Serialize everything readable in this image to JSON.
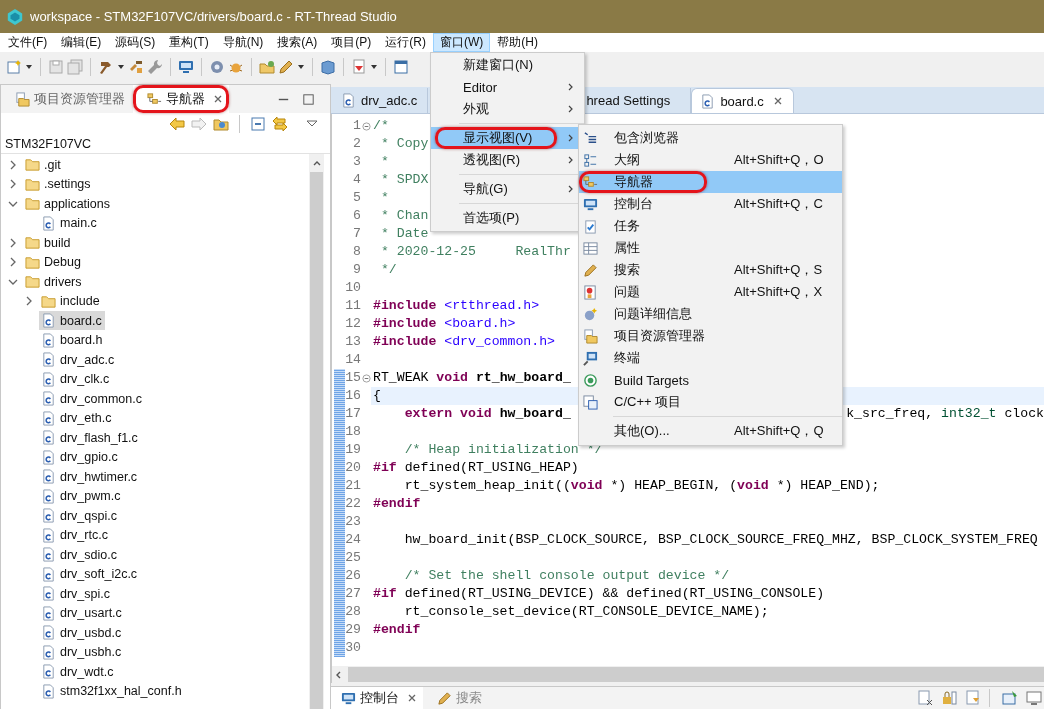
{
  "window": {
    "title": "workspace - STM32F107VC/drivers/board.c - RT-Thread Studio"
  },
  "menu_bar": [
    {
      "label": "文件(F)",
      "selected": false
    },
    {
      "label": "编辑(E)",
      "selected": false
    },
    {
      "label": "源码(S)",
      "selected": false
    },
    {
      "label": "重构(T)",
      "selected": false
    },
    {
      "label": "导航(N)",
      "selected": false
    },
    {
      "label": "搜索(A)",
      "selected": false
    },
    {
      "label": "项目(P)",
      "selected": false
    },
    {
      "label": "运行(R)",
      "selected": false
    },
    {
      "label": "窗口(W)",
      "selected": true
    },
    {
      "label": "帮助(H)",
      "selected": false
    }
  ],
  "left_panel": {
    "tabs": [
      {
        "label": "项目资源管理器",
        "selected": false,
        "highlighted": false
      },
      {
        "label": "导航器",
        "selected": true,
        "highlighted": true
      }
    ],
    "root": "STM32F107VC",
    "tree": [
      {
        "name": ".git",
        "kind": "folder",
        "expanded": false,
        "selected": false
      },
      {
        "name": ".settings",
        "kind": "folder",
        "expanded": false,
        "selected": false
      },
      {
        "name": "applications",
        "kind": "folder",
        "expanded": true,
        "selected": false,
        "children": [
          {
            "name": "main.c",
            "kind": "file",
            "selected": false
          }
        ]
      },
      {
        "name": "build",
        "kind": "folder",
        "expanded": false,
        "selected": false
      },
      {
        "name": "Debug",
        "kind": "folder",
        "expanded": false,
        "selected": false
      },
      {
        "name": "drivers",
        "kind": "folder",
        "expanded": true,
        "selected": false,
        "children": [
          {
            "name": "include",
            "kind": "folder",
            "expanded": false,
            "selected": false
          },
          {
            "name": "board.c",
            "kind": "file",
            "selected": true
          },
          {
            "name": "board.h",
            "kind": "file",
            "selected": false
          },
          {
            "name": "drv_adc.c",
            "kind": "file",
            "selected": false
          },
          {
            "name": "drv_clk.c",
            "kind": "file",
            "selected": false
          },
          {
            "name": "drv_common.c",
            "kind": "file",
            "selected": false
          },
          {
            "name": "drv_eth.c",
            "kind": "file",
            "selected": false
          },
          {
            "name": "drv_flash_f1.c",
            "kind": "file",
            "selected": false
          },
          {
            "name": "drv_gpio.c",
            "kind": "file",
            "selected": false
          },
          {
            "name": "drv_hwtimer.c",
            "kind": "file",
            "selected": false
          },
          {
            "name": "drv_pwm.c",
            "kind": "file",
            "selected": false
          },
          {
            "name": "drv_qspi.c",
            "kind": "file",
            "selected": false
          },
          {
            "name": "drv_rtc.c",
            "kind": "file",
            "selected": false
          },
          {
            "name": "drv_sdio.c",
            "kind": "file",
            "selected": false
          },
          {
            "name": "drv_soft_i2c.c",
            "kind": "file",
            "selected": false
          },
          {
            "name": "drv_spi.c",
            "kind": "file",
            "selected": false
          },
          {
            "name": "drv_usart.c",
            "kind": "file",
            "selected": false
          },
          {
            "name": "drv_usbd.c",
            "kind": "file",
            "selected": false
          },
          {
            "name": "drv_usbh.c",
            "kind": "file",
            "selected": false
          },
          {
            "name": "drv_wdt.c",
            "kind": "file",
            "selected": false
          },
          {
            "name": "stm32f1xx_hal_conf.h",
            "kind": "file",
            "selected": false
          }
        ]
      }
    ]
  },
  "editor": {
    "tabs": [
      {
        "label": "drv_adc.c",
        "selected": false,
        "kind": "file"
      },
      {
        "label": "hread Settings",
        "selected": false,
        "kind": "settings"
      },
      {
        "label": "board.c",
        "selected": true,
        "kind": "file"
      }
    ],
    "lines": [
      {
        "n": "1",
        "fold": true,
        "changed": false,
        "current": false,
        "tokens": [
          {
            "kind": "comment",
            "text": "/*"
          }
        ]
      },
      {
        "n": "2",
        "fold": false,
        "changed": false,
        "current": false,
        "tokens": [
          {
            "kind": "comment",
            "text": " * Copy"
          }
        ]
      },
      {
        "n": "3",
        "fold": false,
        "changed": false,
        "current": false,
        "tokens": [
          {
            "kind": "comment",
            "text": " *"
          }
        ]
      },
      {
        "n": "4",
        "fold": false,
        "changed": false,
        "current": false,
        "tokens": [
          {
            "kind": "comment",
            "text": " * SPDX"
          }
        ]
      },
      {
        "n": "5",
        "fold": false,
        "changed": false,
        "current": false,
        "tokens": [
          {
            "kind": "comment",
            "text": " *"
          }
        ]
      },
      {
        "n": "6",
        "fold": false,
        "changed": false,
        "current": false,
        "tokens": [
          {
            "kind": "comment",
            "text": " * Chan"
          }
        ]
      },
      {
        "n": "7",
        "fold": false,
        "changed": false,
        "current": false,
        "tokens": [
          {
            "kind": "comment",
            "text": " * Date"
          }
        ]
      },
      {
        "n": "8",
        "fold": false,
        "changed": false,
        "current": false,
        "tokens": [
          {
            "kind": "comment",
            "text": " * 2020-12-25     RealThr"
          }
        ]
      },
      {
        "n": "9",
        "fold": false,
        "changed": false,
        "current": false,
        "tokens": [
          {
            "kind": "comment",
            "text": " */"
          }
        ]
      },
      {
        "n": "10",
        "fold": false,
        "changed": false,
        "current": false
      },
      {
        "n": "11",
        "fold": false,
        "changed": false,
        "current": false,
        "tokens": [
          {
            "kind": "keyword",
            "text": "#include"
          },
          {
            "kind": "string",
            "text": " <rtthread.h>"
          }
        ]
      },
      {
        "n": "12",
        "fold": false,
        "changed": false,
        "current": false,
        "tokens": [
          {
            "kind": "keyword",
            "text": "#include"
          },
          {
            "kind": "string",
            "text": " <board.h>"
          }
        ]
      },
      {
        "n": "13",
        "fold": false,
        "changed": false,
        "current": false,
        "tokens": [
          {
            "kind": "keyword",
            "text": "#include"
          },
          {
            "kind": "string",
            "text": " <drv_common.h>"
          }
        ]
      },
      {
        "n": "14",
        "fold": false,
        "changed": false,
        "current": false
      },
      {
        "n": "15",
        "fold": true,
        "changed": true,
        "current": false,
        "tokens": [
          {
            "kind": "plain",
            "text": "RT_WEAK"
          },
          {
            "kind": "keyword",
            "text": " void"
          },
          {
            "kind": "function",
            "text": " rt_hw_board_"
          }
        ]
      },
      {
        "n": "16",
        "fold": false,
        "changed": true,
        "current": true,
        "tokens": [
          {
            "kind": "plain",
            "text": "{"
          }
        ]
      },
      {
        "n": "17",
        "fold": false,
        "changed": true,
        "current": false,
        "tokens": [
          {
            "kind": "keyword",
            "text": "    extern"
          },
          {
            "kind": "keyword",
            "text": " void"
          },
          {
            "kind": "function",
            "text": " hw_board_"
          }
        ],
        "tail": [
          {
            "kind": "plain",
            "text": "k_src_freq,"
          },
          {
            "kind": "type",
            "text": " int32_t"
          },
          {
            "kind": "plain",
            "text": " clock"
          }
        ]
      },
      {
        "n": "18",
        "fold": false,
        "changed": true,
        "current": false
      },
      {
        "n": "19",
        "fold": false,
        "changed": true,
        "current": false,
        "tokens": [
          {
            "kind": "comment",
            "text": "    /* Heap initialization */"
          }
        ]
      },
      {
        "n": "20",
        "fold": false,
        "changed": true,
        "current": false,
        "tokens": [
          {
            "kind": "keyword",
            "text": "#if"
          },
          {
            "kind": "plain",
            "text": " defined(RT_USING_HEAP)"
          }
        ]
      },
      {
        "n": "21",
        "fold": false,
        "changed": true,
        "current": false,
        "tokens": [
          {
            "kind": "plain",
            "text": "    rt_system_heap_init(("
          },
          {
            "kind": "keyword",
            "text": "void"
          },
          {
            "kind": "plain",
            "text": " *) HEAP_BEGIN, ("
          },
          {
            "kind": "keyword",
            "text": "void"
          },
          {
            "kind": "plain",
            "text": " *) HEAP_END);"
          }
        ]
      },
      {
        "n": "22",
        "fold": false,
        "changed": true,
        "current": false,
        "tokens": [
          {
            "kind": "keyword",
            "text": "#endif"
          }
        ]
      },
      {
        "n": "23",
        "fold": false,
        "changed": true,
        "current": false
      },
      {
        "n": "24",
        "fold": false,
        "changed": true,
        "current": false,
        "tokens": [
          {
            "kind": "plain",
            "text": "    hw_board_init(BSP_CLOCK_SOURCE, BSP_CLOCK_SOURCE_FREQ_MHZ, BSP_CLOCK_SYSTEM_FREQ"
          }
        ]
      },
      {
        "n": "25",
        "fold": false,
        "changed": true,
        "current": false
      },
      {
        "n": "26",
        "fold": false,
        "changed": true,
        "current": false,
        "tokens": [
          {
            "kind": "comment",
            "text": "    /* Set the shell console output device */"
          }
        ]
      },
      {
        "n": "27",
        "fold": false,
        "changed": true,
        "current": false,
        "tokens": [
          {
            "kind": "keyword",
            "text": "#if"
          },
          {
            "kind": "plain",
            "text": " defined(RT_USING_DEVICE) && defined(RT_USING_CONSOLE)"
          }
        ]
      },
      {
        "n": "28",
        "fold": false,
        "changed": true,
        "current": false,
        "tokens": [
          {
            "kind": "plain",
            "text": "    rt_console_set_device(RT_CONSOLE_DEVICE_NAME);"
          }
        ]
      },
      {
        "n": "29",
        "fold": false,
        "changed": true,
        "current": false,
        "tokens": [
          {
            "kind": "keyword",
            "text": "#endif"
          }
        ]
      },
      {
        "n": "30",
        "fold": false,
        "changed": true,
        "current": false
      }
    ]
  },
  "window_menu": [
    {
      "label": "新建窗口(N)",
      "kind": "item",
      "submenu": false,
      "selected": false,
      "highlighted": false
    },
    {
      "label": "Editor",
      "kind": "item",
      "submenu": true,
      "selected": false,
      "highlighted": false
    },
    {
      "label": "外观",
      "kind": "item",
      "submenu": true,
      "selected": false,
      "highlighted": false
    },
    {
      "kind": "separator"
    },
    {
      "label": "显示视图(V)",
      "kind": "item",
      "submenu": true,
      "selected": true,
      "highlighted": true
    },
    {
      "label": "透视图(R)",
      "kind": "item",
      "submenu": true,
      "selected": false,
      "highlighted": false
    },
    {
      "kind": "separator"
    },
    {
      "label": "导航(G)",
      "kind": "item",
      "submenu": true,
      "selected": false,
      "highlighted": false
    },
    {
      "kind": "separator"
    },
    {
      "label": "首选项(P)",
      "kind": "item",
      "submenu": false,
      "selected": false,
      "highlighted": false
    }
  ],
  "show_view_menu": [
    {
      "label": "包含浏览器",
      "kind": "item",
      "selected": false,
      "highlighted": false
    },
    {
      "label": "大纲",
      "kind": "item",
      "shortcut": "Alt+Shift+Q，O",
      "selected": false,
      "highlighted": false
    },
    {
      "label": "导航器",
      "kind": "item",
      "selected": true,
      "highlighted": true
    },
    {
      "label": "控制台",
      "kind": "item",
      "shortcut": "Alt+Shift+Q，C",
      "selected": false,
      "highlighted": false
    },
    {
      "label": "任务",
      "kind": "item",
      "selected": false,
      "highlighted": false
    },
    {
      "label": "属性",
      "kind": "item",
      "selected": false,
      "highlighted": false
    },
    {
      "label": "搜索",
      "kind": "item",
      "shortcut": "Alt+Shift+Q，S",
      "selected": false,
      "highlighted": false
    },
    {
      "label": "问题",
      "kind": "item",
      "shortcut": "Alt+Shift+Q，X",
      "selected": false,
      "highlighted": false
    },
    {
      "label": "问题详细信息",
      "kind": "item",
      "selected": false,
      "highlighted": false
    },
    {
      "label": "项目资源管理器",
      "kind": "item",
      "selected": false,
      "highlighted": false
    },
    {
      "label": "终端",
      "kind": "item",
      "selected": false,
      "highlighted": false
    },
    {
      "label": "Build Targets",
      "kind": "item",
      "selected": false,
      "highlighted": false
    },
    {
      "label": "C/C++ 项目",
      "kind": "item",
      "selected": false,
      "highlighted": false
    },
    {
      "kind": "separator"
    },
    {
      "label": "其他(O)...",
      "kind": "item",
      "shortcut": "Alt+Shift+Q，Q",
      "selected": false,
      "highlighted": false
    }
  ],
  "bottom_panel": {
    "tabs": [
      {
        "label": "控制台",
        "selected": true
      },
      {
        "label": "搜索",
        "selected": false
      }
    ]
  }
}
